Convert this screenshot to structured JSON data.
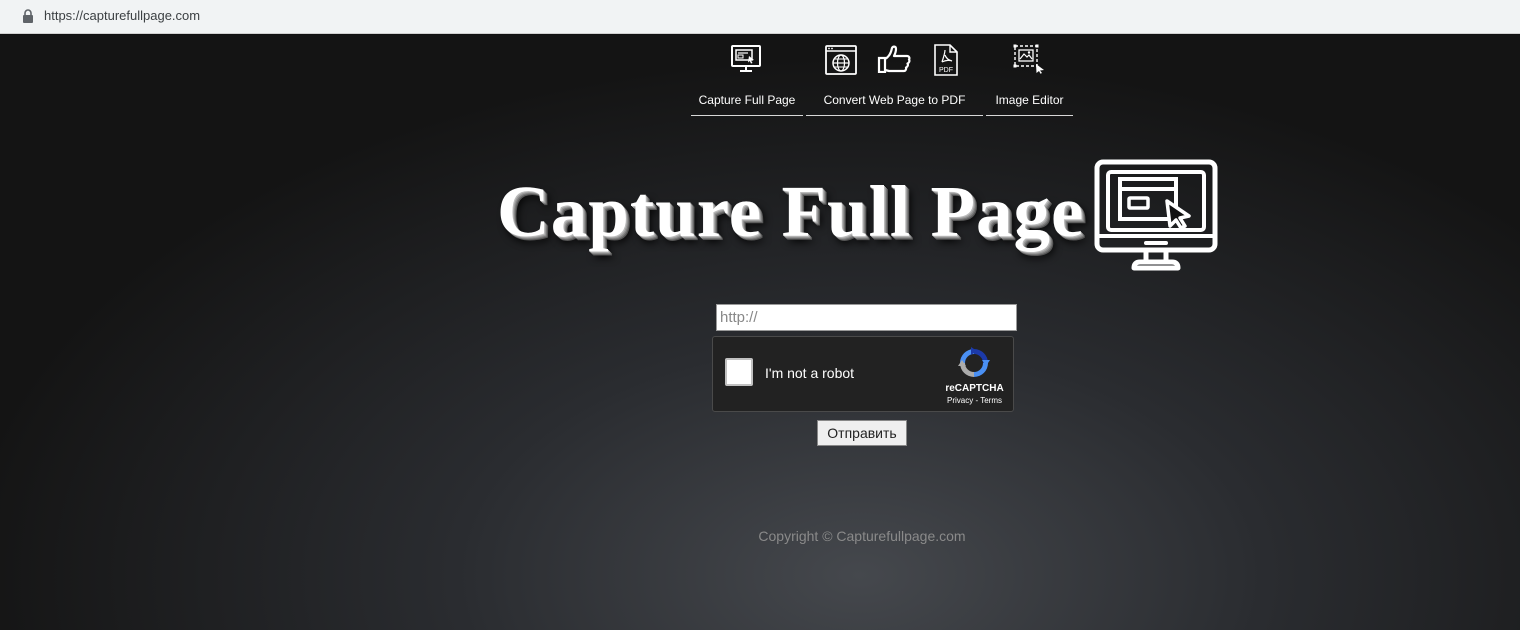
{
  "browser": {
    "url": "https://capturefullpage.com",
    "lock_icon": "lock-icon"
  },
  "nav": {
    "items": [
      {
        "label": "Capture Full Page",
        "icons": [
          "monitor-icon"
        ]
      },
      {
        "label": "Convert Web Page to PDF",
        "icons": [
          "globe-page-icon",
          "thumbs-up-icon",
          "pdf-file-icon"
        ]
      },
      {
        "label": "Image Editor",
        "icons": [
          "image-select-icon"
        ]
      }
    ]
  },
  "hero": {
    "title": "Capture Full Page",
    "icon": "monitor-cursor-icon"
  },
  "form": {
    "url_placeholder": "http://",
    "url_value": "",
    "captcha_label": "I'm not a robot",
    "captcha_brand": "reCAPTCHA",
    "captcha_links": "Privacy - Terms",
    "submit_label": "Отправить"
  },
  "footer": {
    "copyright": "Copyright © Capturefullpage.com"
  }
}
